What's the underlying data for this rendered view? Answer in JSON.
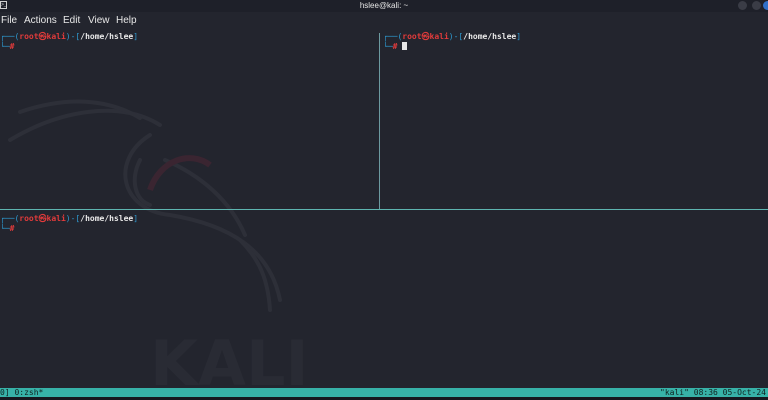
{
  "window": {
    "title": "hslee@kali: ~",
    "icon": "terminal-icon"
  },
  "menu": {
    "file": "File",
    "actions": "Actions",
    "edit": "Edit",
    "view": "View",
    "help": "Help"
  },
  "panes": [
    {
      "user": "root",
      "at": "㉿",
      "host": "kali",
      "path": "/home/hslee",
      "symbol": "#"
    },
    {
      "user": "root",
      "at": "㉿",
      "host": "kali",
      "path": "/home/hslee",
      "symbol": "#"
    },
    {
      "user": "root",
      "at": "㉿",
      "host": "kali",
      "path": "/home/hslee",
      "symbol": "#"
    }
  ],
  "status": {
    "left": "0] 0:zsh*",
    "right": "\"kali\" 08:36 05-Oct-24"
  },
  "watermark": "KALI",
  "colors": {
    "background": "#23252e",
    "status_bar": "#37b2a8",
    "prompt_red": "#e23b3b",
    "bracket_blue": "#2e9ad0"
  }
}
